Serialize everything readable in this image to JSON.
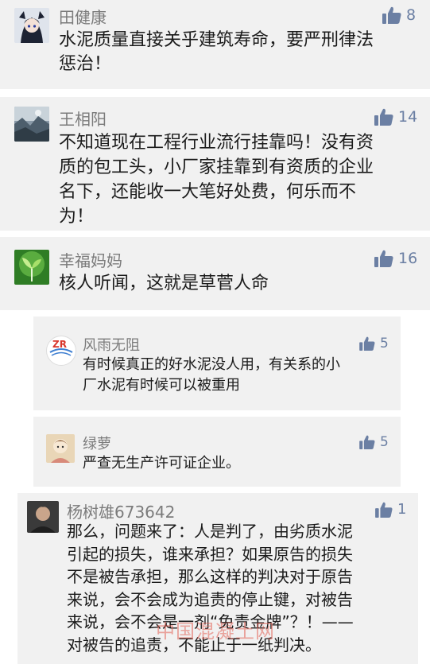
{
  "comments": [
    {
      "user": "田健康",
      "likes": "8",
      "text": "水泥质量直接关乎建筑寿命，要严刑律法\n惩治！",
      "avatar": "anime-character-avatar"
    },
    {
      "user": "王相阳",
      "likes": "14",
      "text": "不知道现在工程行业流行挂靠吗！没有资\n质的包工头，小厂家挂靠到有资质的企业\n名下，还能收一大笔好处费，何乐而不\n为！",
      "avatar": "landscape-photo-avatar"
    },
    {
      "user": "幸福妈妈",
      "likes": "16",
      "text": "核人听闻，这就是草菅人命",
      "avatar": "green-sprout-avatar"
    },
    {
      "user": "风雨无阻",
      "likes": "5",
      "text": "有时候真正的好水泥没人用，有关系的小\n厂水泥有时候可以被重用",
      "avatar": "zr-logo-avatar",
      "logo_text": "ZR"
    },
    {
      "user": "绿萝",
      "likes": "5",
      "text": "严查无生产许可证企业。",
      "avatar": "cartoon-photo-avatar"
    },
    {
      "user": "杨树雄673642",
      "likes": "1",
      "text": "那么，问题来了：人是判了，由劣质水泥\n引起的损失，谁来承担？如果原告的损失\n不是被告承担，那么这样的判决对于原告\n来说，会不会成为追责的停止键，对被告\n来说，会不会是一剂“免责金牌”？！——\n对被告的追责，不能止于一纸判决。",
      "avatar": "portrait-photo-avatar"
    }
  ],
  "watermark": "中国混凝土网",
  "colors": {
    "card_bg": "#f1f1f1",
    "name": "#7b7b7b",
    "text": "#1b1b1b",
    "like": "#6b7fa3"
  }
}
